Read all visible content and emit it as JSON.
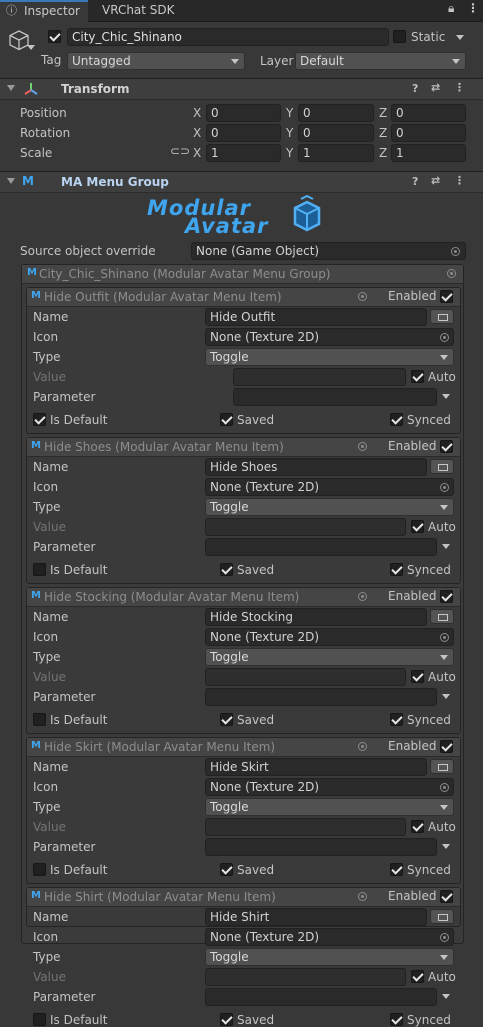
{
  "tabs": [
    {
      "label": "Inspector"
    },
    {
      "label": "VRChat SDK"
    }
  ],
  "gameobject": {
    "name": "City_Chic_Shinano",
    "static_label": "Static",
    "tag_label": "Tag",
    "tag_value": "Untagged",
    "layer_label": "Layer",
    "layer_value": "Default"
  },
  "transform": {
    "title": "Transform",
    "rows": [
      {
        "label": "Position",
        "x": "0",
        "y": "0",
        "z": "0"
      },
      {
        "label": "Rotation",
        "x": "0",
        "y": "0",
        "z": "0"
      },
      {
        "label": "Scale",
        "x": "1",
        "y": "1",
        "z": "1"
      }
    ],
    "axis": {
      "x": "X",
      "y": "Y",
      "z": "Z"
    }
  },
  "menu_group": {
    "title": "MA Menu Group",
    "logo_line1": "Modular",
    "logo_line2": "Avatar",
    "source_label": "Source object override",
    "source_value": "None (Game Object)",
    "group_title": "City_Chic_Shinano (Modular Avatar Menu Group)"
  },
  "labels": {
    "enabled": "Enabled",
    "name": "Name",
    "icon": "Icon",
    "type": "Type",
    "value": "Value",
    "parameter": "Parameter",
    "auto": "Auto",
    "is_default": "Is Default",
    "saved": "Saved",
    "synced": "Synced",
    "texture_none": "None (Texture 2D)",
    "toggle": "Toggle"
  },
  "items": [
    {
      "title": "Hide Outfit (Modular Avatar Menu Item)",
      "name": "Hide Outfit",
      "is_default": true
    },
    {
      "title": "Hide Shoes (Modular Avatar Menu Item)",
      "name": "Hide Shoes",
      "is_default": false
    },
    {
      "title": "Hide Stocking (Modular Avatar Menu Item)",
      "name": "Hide Stocking",
      "is_default": false
    },
    {
      "title": "Hide Skirt (Modular Avatar Menu Item)",
      "name": "Hide Skirt",
      "is_default": false
    },
    {
      "title": "Hide Shirt (Modular Avatar Menu Item)",
      "name": "Hide Shirt",
      "is_default": false
    }
  ]
}
